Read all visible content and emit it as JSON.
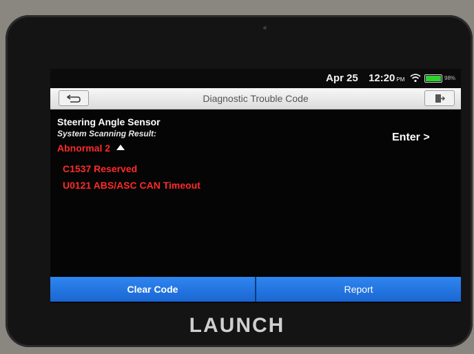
{
  "status": {
    "date": "Apr 25",
    "time": "12:20",
    "ampm": "PM",
    "battery": "98%"
  },
  "header": {
    "title": "Diagnostic Trouble Code"
  },
  "main": {
    "system_name": "Steering Angle Sensor",
    "scan_label": "System Scanning Result:",
    "result": "Abnormal 2",
    "enter_label": "Enter >",
    "dtcs": [
      "C1537 Reserved",
      "U0121 ABS/ASC CAN Timeout"
    ]
  },
  "buttons": {
    "clear_code": "Clear Code",
    "report": "Report"
  },
  "device": {
    "brand": "LAUNCH"
  },
  "colors": {
    "accent": "#2f86f0",
    "error": "#ff2a2a",
    "battery": "#2fd12f"
  },
  "icons": {
    "back": "back-arrow-icon",
    "exit": "exit-icon",
    "wifi": "wifi-icon",
    "battery": "battery-icon",
    "expand": "triangle-up-icon"
  }
}
